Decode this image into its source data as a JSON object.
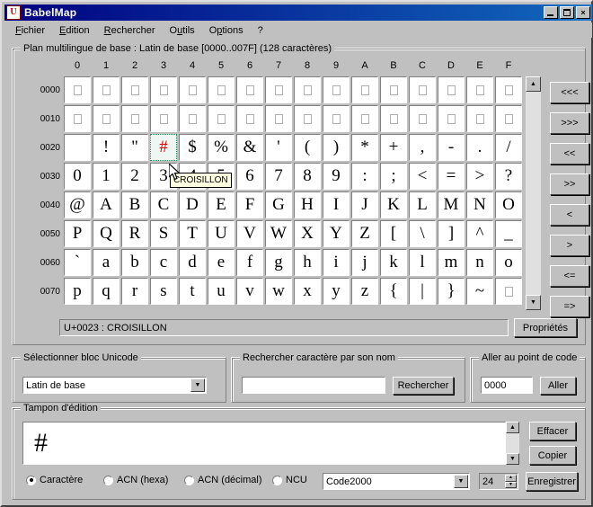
{
  "window": {
    "title": "BabelMap",
    "icon": "U",
    "buttons": {
      "minimize": "minimize-icon",
      "maximize": "maximize-icon",
      "close": "×"
    }
  },
  "menu": [
    {
      "label": "Fichier",
      "accel": "F"
    },
    {
      "label": "Edition",
      "accel": "E"
    },
    {
      "label": "Rechercher",
      "accel": "R"
    },
    {
      "label": "Outils",
      "accel": "u"
    },
    {
      "label": "Options",
      "accel": "p"
    },
    {
      "label": "?",
      "accel": ""
    }
  ],
  "grid": {
    "legend": "Plan multilingue de base : Latin de base [0000..007F] (128 caractères)",
    "columns": [
      "0",
      "1",
      "2",
      "3",
      "4",
      "5",
      "6",
      "7",
      "8",
      "9",
      "A",
      "B",
      "C",
      "D",
      "E",
      "F"
    ],
    "rows": [
      {
        "label": "0000",
        "cells": [
          "",
          "",
          "",
          "",
          "",
          "",
          "",
          "",
          "",
          "",
          "",
          "",
          "",
          "",
          "",
          ""
        ],
        "control": true
      },
      {
        "label": "0010",
        "cells": [
          "",
          "",
          "",
          "",
          "",
          "",
          "",
          "",
          "",
          "",
          "",
          "",
          "",
          "",
          "",
          ""
        ],
        "control": true
      },
      {
        "label": "0020",
        "cells": [
          " ",
          "!",
          "\"",
          "#",
          "$",
          "%",
          "&",
          "'",
          "(",
          ")",
          "*",
          "+",
          ",",
          "-",
          ".",
          "/"
        ]
      },
      {
        "label": "0030",
        "cells": [
          "0",
          "1",
          "2",
          "3",
          "4",
          "5",
          "6",
          "7",
          "8",
          "9",
          ":",
          ";",
          "<",
          "=",
          ">",
          "?"
        ]
      },
      {
        "label": "0040",
        "cells": [
          "@",
          "A",
          "B",
          "C",
          "D",
          "E",
          "F",
          "G",
          "H",
          "I",
          "J",
          "K",
          "L",
          "M",
          "N",
          "O"
        ]
      },
      {
        "label": "0050",
        "cells": [
          "P",
          "Q",
          "R",
          "S",
          "T",
          "U",
          "V",
          "W",
          "X",
          "Y",
          "Z",
          "[",
          "\\",
          "]",
          "^",
          "_"
        ]
      },
      {
        "label": "0060",
        "cells": [
          "`",
          "a",
          "b",
          "c",
          "d",
          "e",
          "f",
          "g",
          "h",
          "i",
          "j",
          "k",
          "l",
          "m",
          "n",
          "o"
        ]
      },
      {
        "label": "0070",
        "cells": [
          "p",
          "q",
          "r",
          "s",
          "t",
          "u",
          "v",
          "w",
          "x",
          "y",
          "z",
          "{",
          "|",
          "}",
          "~",
          ""
        ],
        "last_control": true
      }
    ],
    "selected": {
      "row": 2,
      "col": 3,
      "char": "#",
      "color": "#e00000"
    },
    "tooltip": "CROISILLON",
    "nav_buttons": [
      "<<<",
      ">>>",
      "<<",
      ">>",
      "<",
      ">",
      "<=",
      "=>"
    ],
    "scroll": {
      "up": "▲",
      "down": "▼"
    }
  },
  "status": {
    "text": "U+0023 : CROISILLON",
    "properties_button": "Propriétés"
  },
  "block_select": {
    "legend": "Sélectionner bloc Unicode",
    "value": "Latin de base"
  },
  "search": {
    "legend": "Rechercher caractère par son nom",
    "value": "",
    "placeholder": "",
    "button": "Rechercher"
  },
  "goto": {
    "legend": "Aller au point de code",
    "value": "0000",
    "button": "Aller"
  },
  "buffer": {
    "legend": "Tampon d'édition",
    "value": "#",
    "clear_button": "Effacer",
    "copy_button": "Copier",
    "save_button": "Enregistrer",
    "modes": [
      {
        "label": "Caractère",
        "selected": true
      },
      {
        "label": "ACN (hexa)",
        "selected": false
      },
      {
        "label": "ACN (décimal)",
        "selected": false
      },
      {
        "label": "NCU",
        "selected": false
      }
    ],
    "font": "Code2000",
    "font_size": "24"
  }
}
